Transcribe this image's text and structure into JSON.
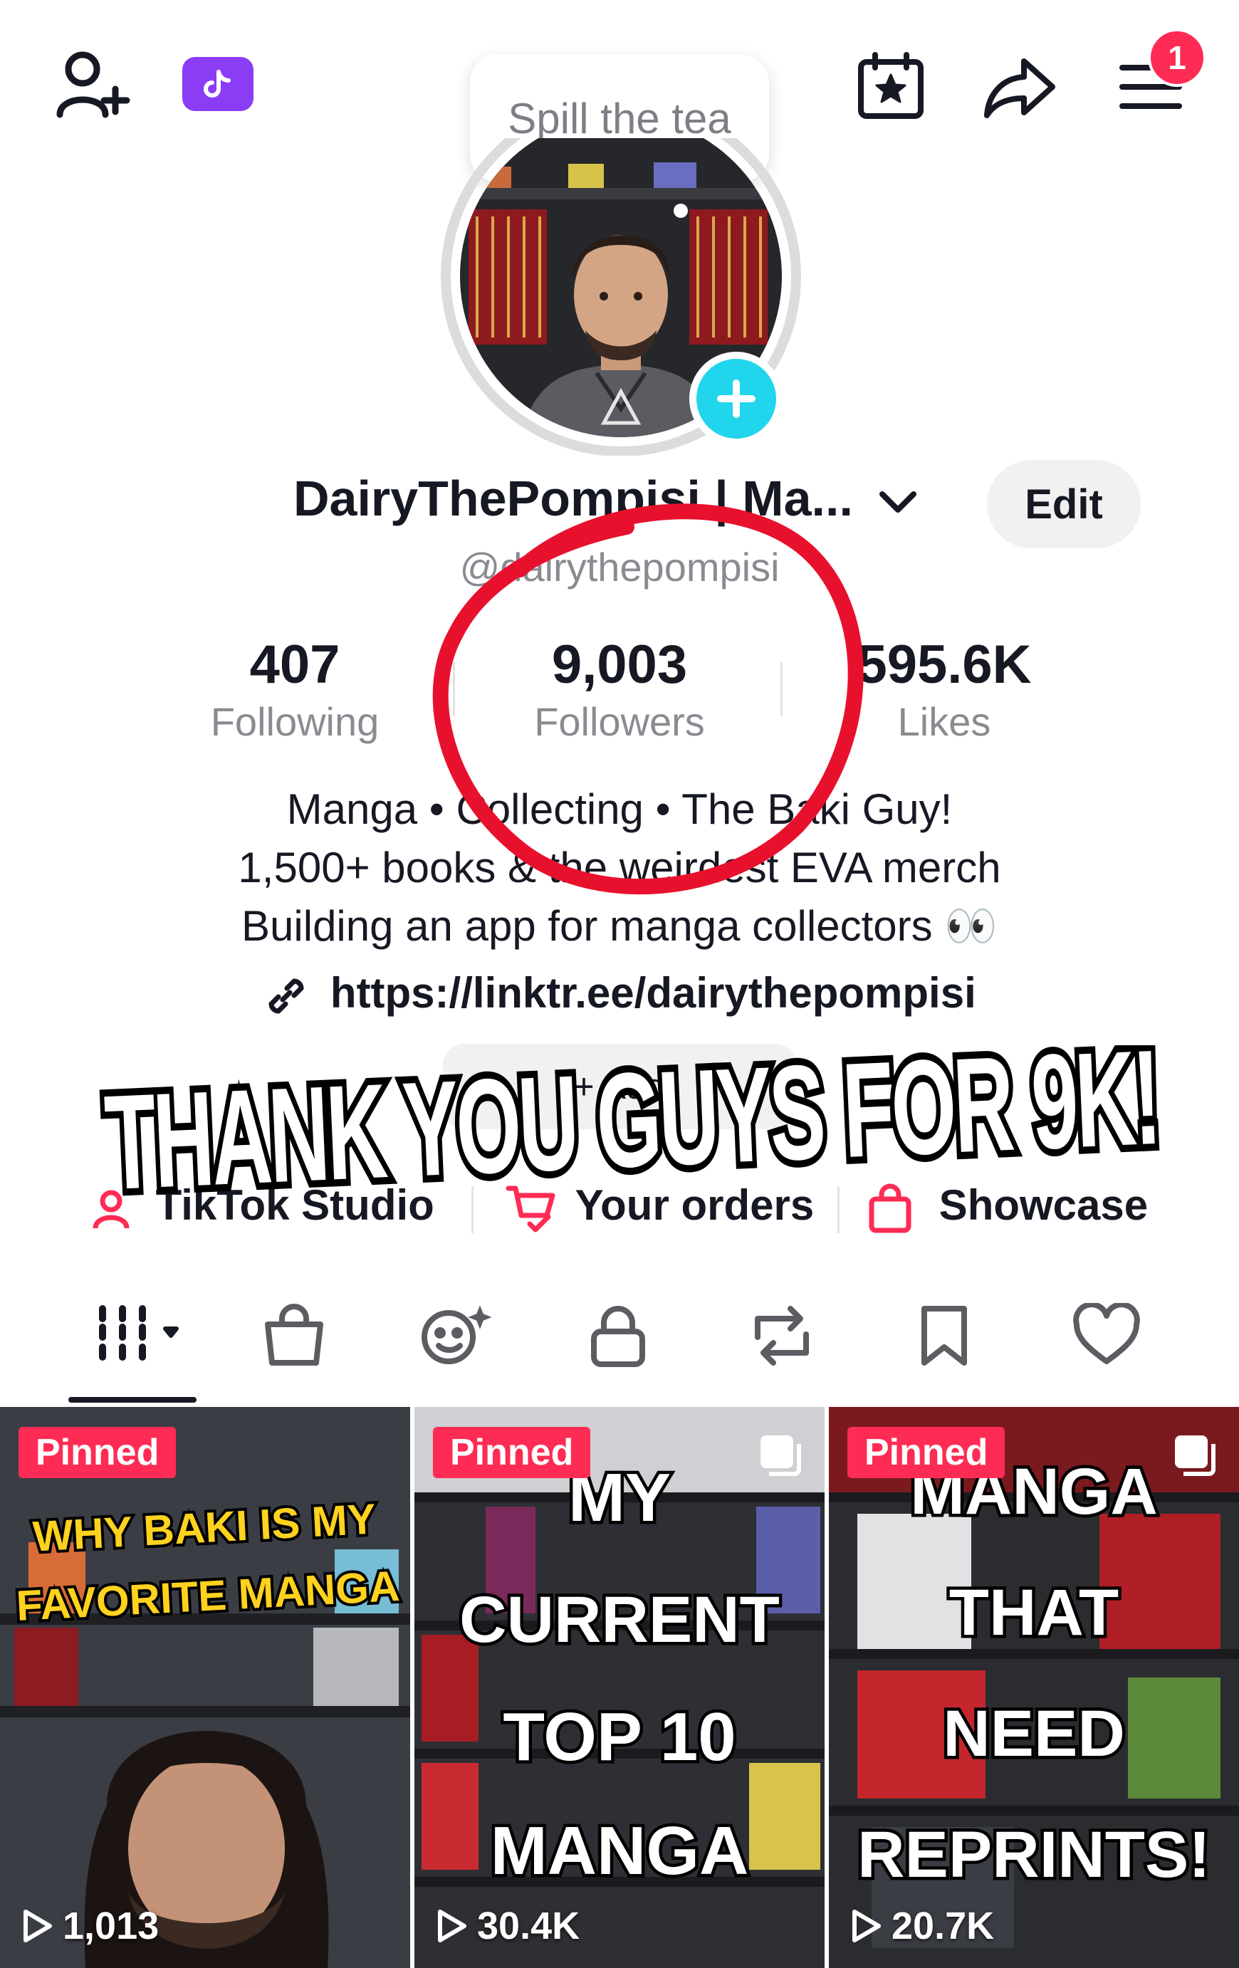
{
  "header": {
    "notification_count": "1",
    "prompt_bubble": "Spill the tea"
  },
  "profile": {
    "display_name": "DairyThePompisi | Ma...",
    "edit_label": "Edit",
    "handle": "@dairythepompisi"
  },
  "stats": [
    {
      "value": "407",
      "label": "Following"
    },
    {
      "value": "9,003",
      "label": "Followers"
    },
    {
      "value": "595.6K",
      "label": "Likes"
    }
  ],
  "bio": {
    "line1": "Manga • Collecting • The Baki Guy!",
    "line2": "1,500+ books & the weirdest EVA merch",
    "line3": "Building an app for manga collectors 👀",
    "link": "https://linktr.ee/dairythepompisi"
  },
  "add_button_label": "+ Add",
  "overlay_caption": "THANK YOU GUYS FOR 9K!",
  "shortcuts": [
    {
      "label": "TikTok Studio"
    },
    {
      "label": "Your orders"
    },
    {
      "label": "Showcase"
    }
  ],
  "tabs": [
    {
      "icon": "grid-icon"
    },
    {
      "icon": "shop-bag-icon"
    },
    {
      "icon": "ai-self-icon"
    },
    {
      "icon": "lock-icon"
    },
    {
      "icon": "repost-icon"
    },
    {
      "icon": "bookmark-icon"
    },
    {
      "icon": "heart-icon"
    }
  ],
  "videos": [
    {
      "badge": "Pinned",
      "caption_line1": "WHY BAKI IS MY",
      "caption_line2": "FAVORITE MANGA",
      "views": "1,013"
    },
    {
      "badge": "Pinned",
      "caption_line1": "MY",
      "caption_line2": "CURRENT",
      "caption_line3": "TOP 10",
      "caption_line4": "MANGA",
      "views": "30.4K"
    },
    {
      "badge": "Pinned",
      "caption_line1": "MANGA",
      "caption_line2": "THAT",
      "caption_line3": "NEED",
      "caption_line4": "REPRINTS!",
      "views": "20.7K"
    }
  ],
  "colors": {
    "accent": "#fe2c55",
    "plus_button": "#20d5ec",
    "annotation_circle": "#e8112d"
  }
}
